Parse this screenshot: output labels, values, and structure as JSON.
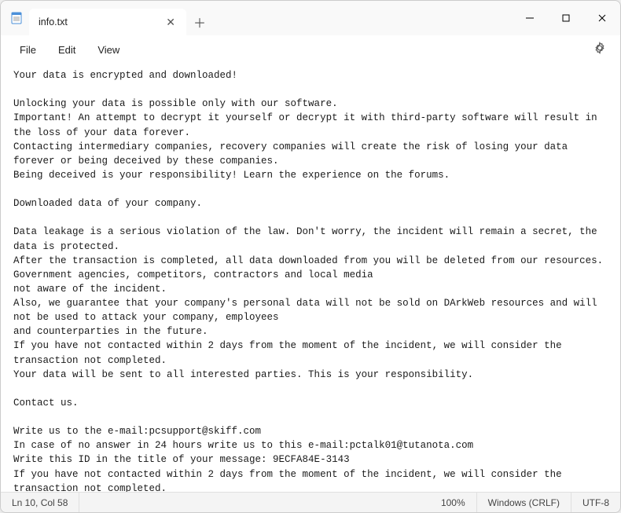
{
  "window": {
    "tab_title": "info.txt"
  },
  "menu": {
    "file": "File",
    "edit": "Edit",
    "view": "View"
  },
  "content": {
    "text": "Your data is encrypted and downloaded!\n\nUnlocking your data is possible only with our software.\nImportant! An attempt to decrypt it yourself or decrypt it with third-party software will result in the loss of your data forever.\nContacting intermediary companies, recovery companies will create the risk of losing your data forever or being deceived by these companies.\nBeing deceived is your responsibility! Learn the experience on the forums.\n\nDownloaded data of your company.\n\nData leakage is a serious violation of the law. Don't worry, the incident will remain a secret, the data is protected.\nAfter the transaction is completed, all data downloaded from you will be deleted from our resources. Government agencies, competitors, contractors and local media\nnot aware of the incident.\nAlso, we guarantee that your company's personal data will not be sold on DArkWeb resources and will not be used to attack your company, employees\nand counterparties in the future.\nIf you have not contacted within 2 days from the moment of the incident, we will consider the transaction not completed.\nYour data will be sent to all interested parties. This is your responsibility.\n\nContact us.\n\nWrite us to the e-mail:pcsupport@skiff.com\nIn case of no answer in 24 hours write us to this e-mail:pctalk01@tutanota.com\nWrite this ID in the title of your message: 9ECFA84E-3143\nIf you have not contacted within 2 days from the moment of the incident, we will consider the transaction not completed.\nYour data will be sent to all interested parties. This is your responsibility."
  },
  "status": {
    "position": "Ln 10, Col 58",
    "zoom": "100%",
    "line_ending": "Windows (CRLF)",
    "encoding": "UTF-8"
  }
}
